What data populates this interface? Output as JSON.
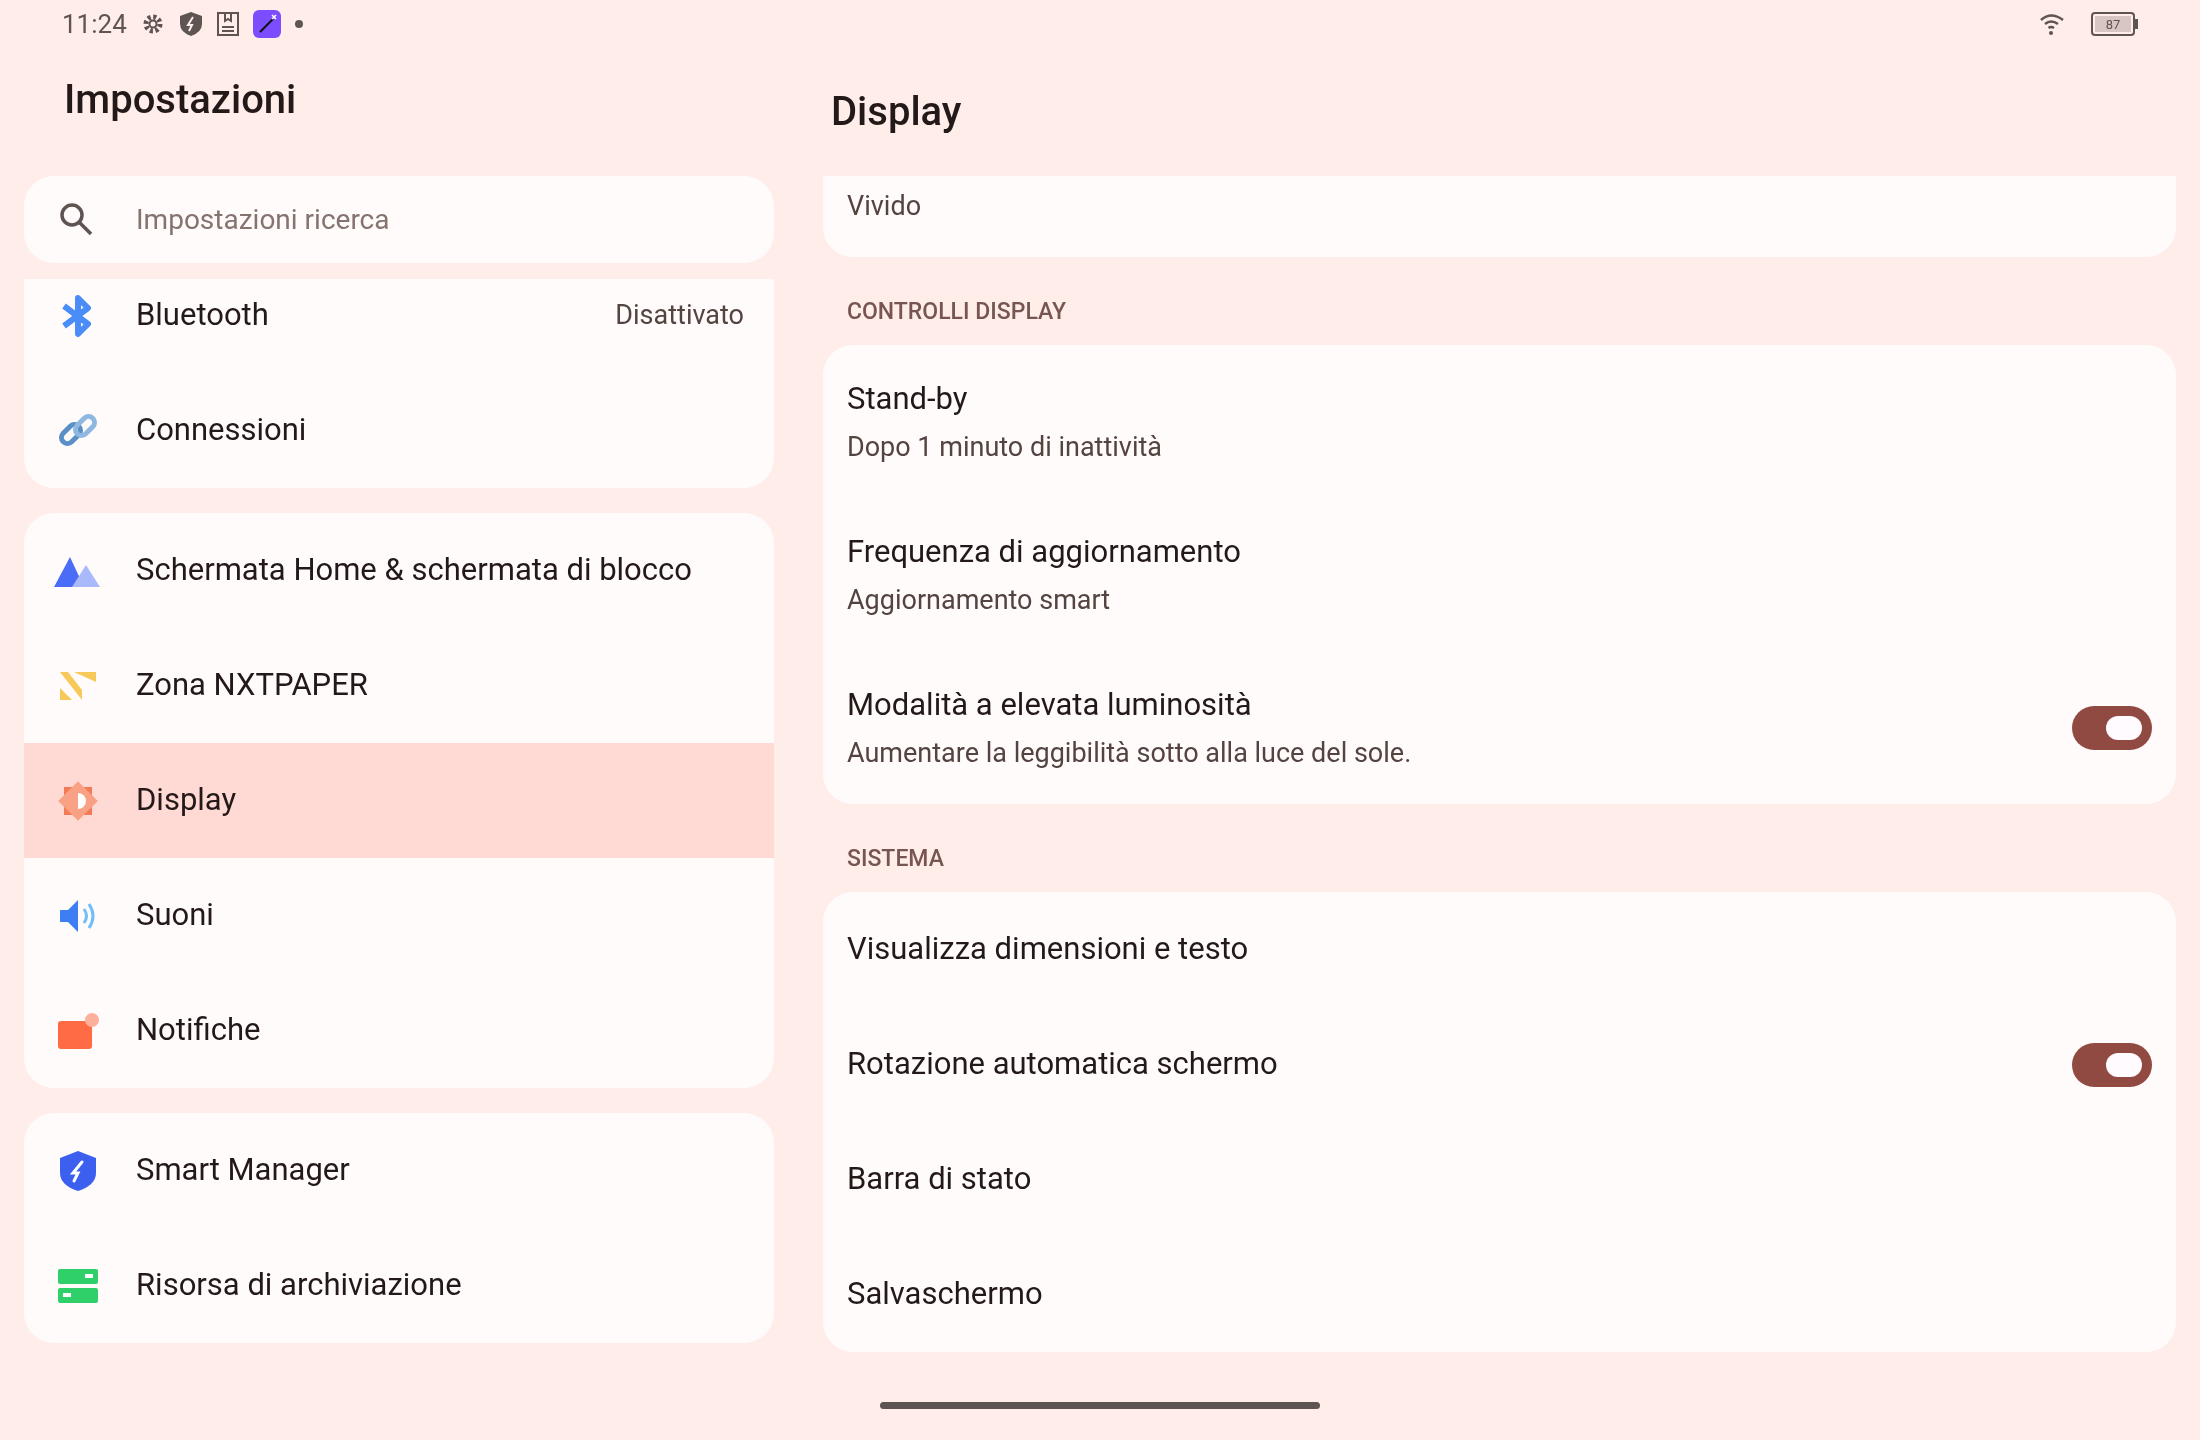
{
  "status_bar": {
    "time": "11:24",
    "battery": "87"
  },
  "sidebar": {
    "title": "Impostazioni",
    "search": {
      "placeholder": "Impostazioni ricerca"
    },
    "groups": [
      {
        "items": [
          {
            "label": "Bluetooth",
            "value": "Disattivato",
            "selected": false
          },
          {
            "label": "Connessioni",
            "selected": false
          }
        ]
      },
      {
        "items": [
          {
            "label": "Schermata Home & schermata di blocco",
            "selected": false
          },
          {
            "label": "Zona NXTPAPER",
            "selected": false
          },
          {
            "label": "Display",
            "selected": true
          },
          {
            "label": "Suoni",
            "selected": false
          },
          {
            "label": "Notifiche",
            "selected": false
          }
        ]
      },
      {
        "items": [
          {
            "label": "Smart Manager",
            "selected": false
          },
          {
            "label": "Risorsa di archiviazione",
            "selected": false
          }
        ]
      }
    ]
  },
  "content": {
    "title": "Display",
    "top_card": {
      "value": "Vivido"
    },
    "sections": [
      {
        "header": "CONTROLLI DISPLAY",
        "rows": [
          {
            "kind": "link",
            "title": "Stand-by",
            "subtitle": "Dopo 1 minuto di inattività"
          },
          {
            "kind": "link",
            "title": "Frequenza di aggiornamento",
            "subtitle": "Aggiornamento smart"
          },
          {
            "kind": "toggle",
            "title": "Modalità a elevata luminosità",
            "subtitle": "Aumentare la leggibilità sotto alla luce del sole.",
            "on": true
          }
        ]
      },
      {
        "header": "SISTEMA",
        "rows": [
          {
            "kind": "link",
            "title": "Visualizza dimensioni e testo"
          },
          {
            "kind": "toggle",
            "title": "Rotazione automatica schermo",
            "on": true
          },
          {
            "kind": "link",
            "title": "Barra di stato"
          },
          {
            "kind": "link",
            "title": "Salvaschermo"
          }
        ]
      }
    ]
  }
}
